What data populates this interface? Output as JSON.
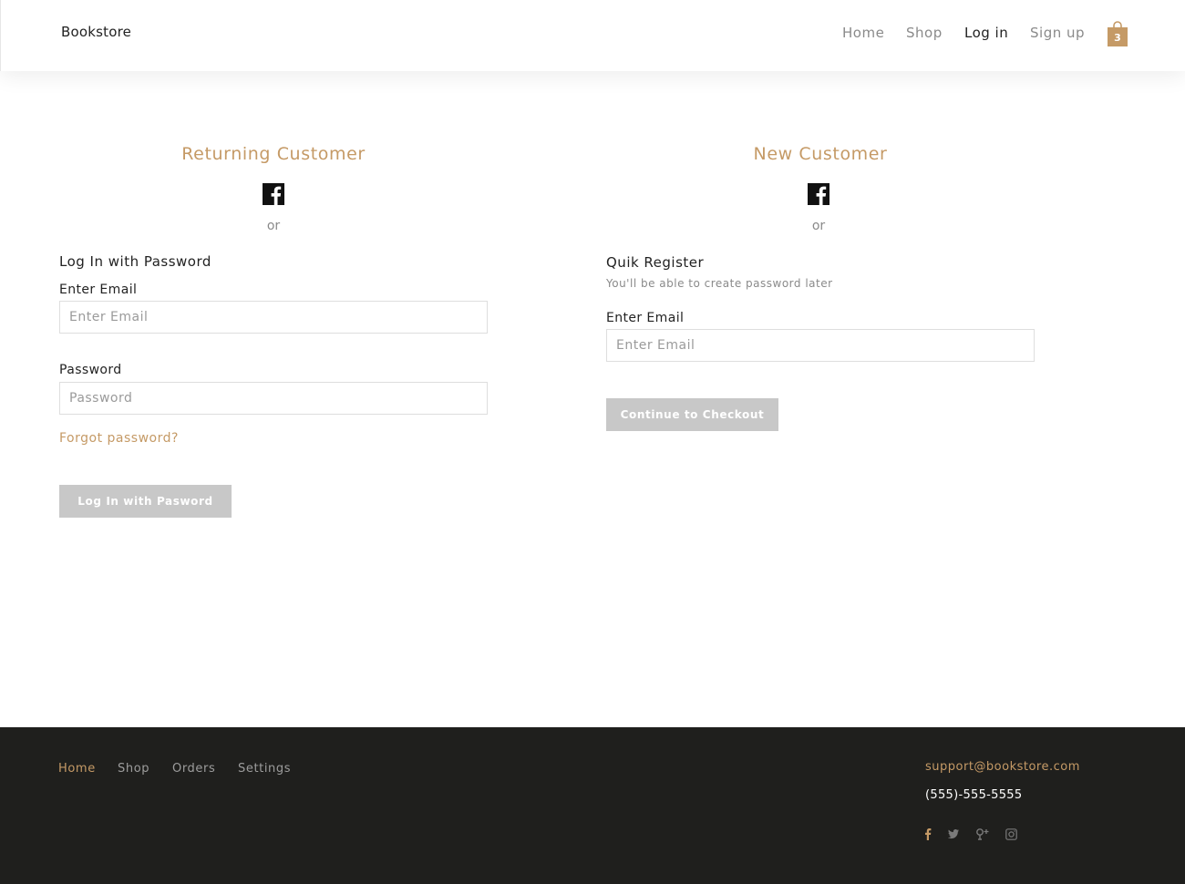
{
  "header": {
    "brand": "Bookstore",
    "nav": [
      "Home",
      "Shop",
      "Log in",
      "Sign up"
    ],
    "active_nav": "Log in",
    "cart_count": "3"
  },
  "returning": {
    "title": "Returning Customer",
    "or_text": "or",
    "section_title": "Log In with Password",
    "email_label": "Enter Email",
    "email_placeholder": "Enter Email",
    "password_label": "Password",
    "password_placeholder": "Password",
    "forgot_link": "Forgot password?",
    "submit_label": "Log In with Pasword"
  },
  "new_customer": {
    "title": "New Customer",
    "or_text": "or",
    "section_title": "Quik Register",
    "hint": "You'll be able to create password later",
    "email_label": "Enter Email",
    "email_placeholder": "Enter Email",
    "submit_label": "Continue to Checkout"
  },
  "footer": {
    "nav": [
      "Home",
      "Shop",
      "Orders",
      "Settings"
    ],
    "active_nav": "Home",
    "email": "support@bookstore.com",
    "phone": "(555)-555-5555",
    "social_icons": [
      "facebook-icon",
      "twitter-icon",
      "google-plus-icon",
      "instagram-icon"
    ]
  },
  "colors": {
    "accent": "#c59a66",
    "button_disabled": "#c8c8c8",
    "footer_bg": "#1f1f1d"
  }
}
